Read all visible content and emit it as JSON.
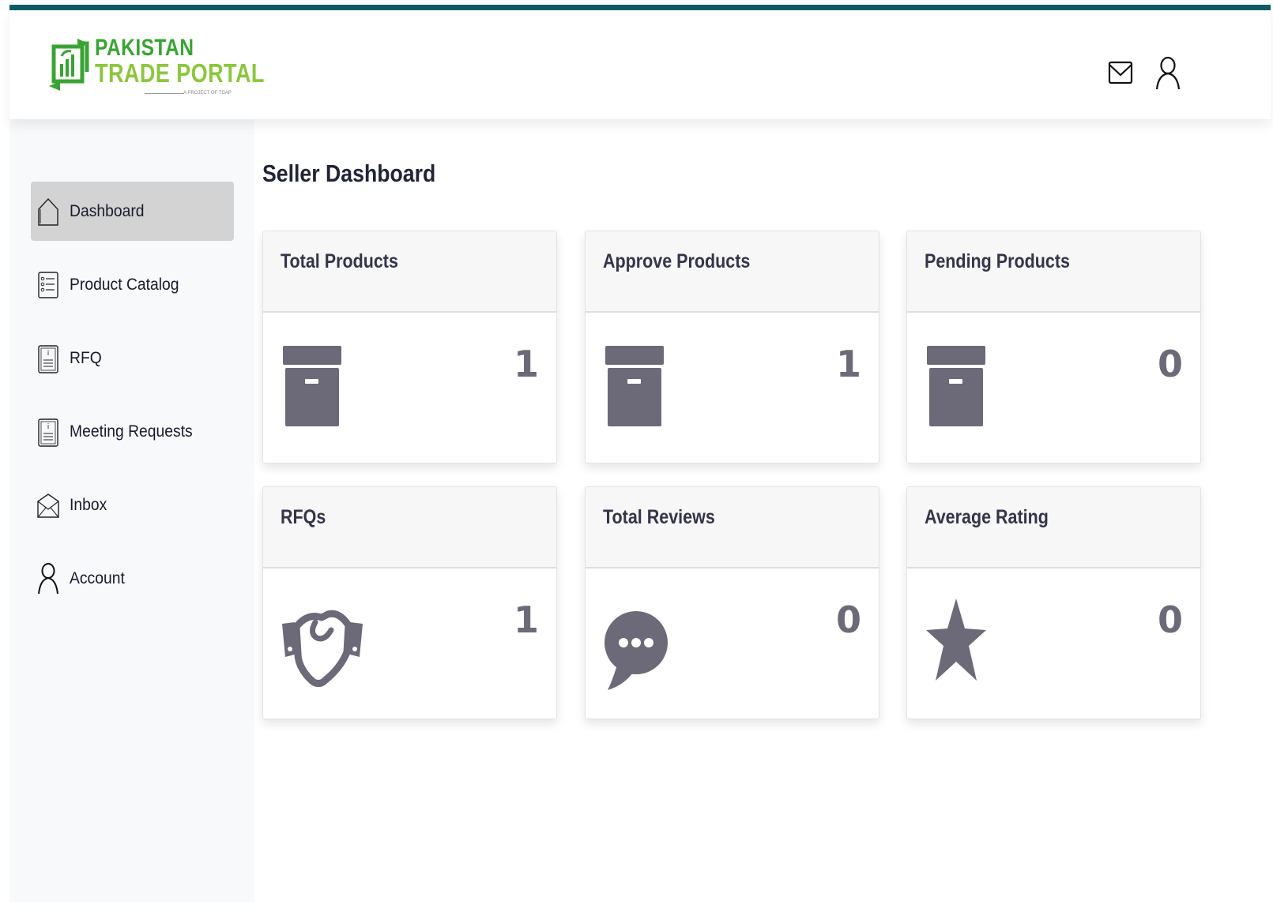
{
  "brand": {
    "line1": "PAKISTAN",
    "line2": "TRADE PORTAL",
    "tagline": "A PROJECT OF TDAP",
    "colors": {
      "primary_green": "#3aa335",
      "light_green": "#8cc63f",
      "top_bar": "#0e5c63"
    }
  },
  "header": {
    "icons": [
      "mail-icon",
      "user-icon"
    ]
  },
  "sidebar": {
    "items": [
      {
        "label": "Dashboard",
        "icon": "home-icon",
        "active": true
      },
      {
        "label": "Product Catalog",
        "icon": "list-icon",
        "active": false
      },
      {
        "label": "RFQ",
        "icon": "document-icon",
        "active": false
      },
      {
        "label": "Meeting Requests",
        "icon": "document-icon",
        "active": false
      },
      {
        "label": "Inbox",
        "icon": "envelope-icon",
        "active": false
      },
      {
        "label": "Account",
        "icon": "user-icon",
        "active": false
      }
    ]
  },
  "main": {
    "title": "Seller Dashboard",
    "cards": [
      {
        "title": "Total Products",
        "value": "1",
        "icon": "archive-box-icon"
      },
      {
        "title": "Approve Products",
        "value": "1",
        "icon": "archive-box-icon"
      },
      {
        "title": "Pending Products",
        "value": "0",
        "icon": "archive-box-icon"
      },
      {
        "title": "RFQs",
        "value": "1",
        "icon": "handshake-icon"
      },
      {
        "title": "Total Reviews",
        "value": "0",
        "icon": "chat-bubble-icon"
      },
      {
        "title": "Average Rating",
        "value": "0",
        "icon": "star-icon"
      }
    ],
    "icon_color": "#6c6a78"
  }
}
